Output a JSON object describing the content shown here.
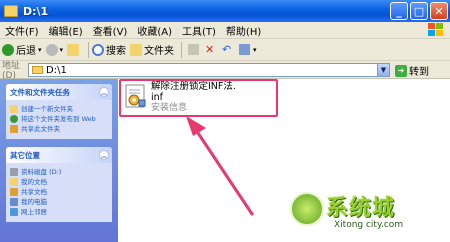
{
  "window": {
    "title": "D:\\1",
    "buttons": {
      "minimize": "_",
      "maximize": "□",
      "close": "✕"
    }
  },
  "menu": [
    "文件(F)",
    "编辑(E)",
    "查看(V)",
    "收藏(A)",
    "工具(T)",
    "帮助(H)"
  ],
  "toolbar": {
    "back": "后退",
    "search": "搜索",
    "folders": "文件夹"
  },
  "address": {
    "label": "地址(D)",
    "value": "D:\\1",
    "go": "转到"
  },
  "tasks": {
    "file_folder": {
      "title": "文件和文件夹任务",
      "items": [
        "创建一个新文件夹",
        "将这个文件夹发布到 Web",
        "共享此文件夹"
      ]
    },
    "other_places": {
      "title": "其它位置",
      "items": [
        "资料磁盘 (D:)",
        "我的文档",
        "共享文档",
        "我的电脑",
        "网上邻居"
      ]
    }
  },
  "file": {
    "name_line1": "解除注册锁定INF法.",
    "name_line2": "inf",
    "type": "安装信息"
  },
  "watermark": {
    "brand": "系统城",
    "url": "Xitong city.com"
  },
  "colors": {
    "titlebar": "#0a5fe0",
    "highlight": "#e8386e",
    "taskpane": "#7ba2e7"
  }
}
